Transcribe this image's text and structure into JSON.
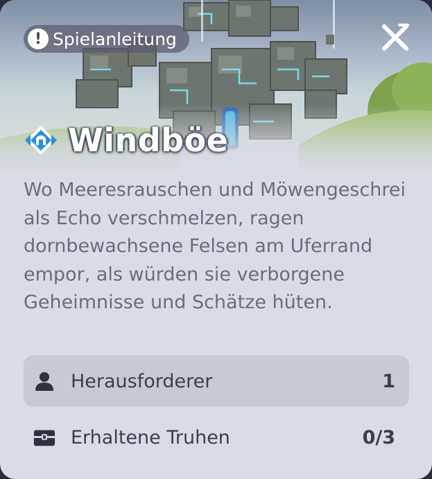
{
  "guide": {
    "label": "Spielanleitung",
    "icon": "exclamation-icon"
  },
  "close": {
    "icon": "close-icon"
  },
  "title": {
    "text": "Windböe",
    "icon": "domain-gate-icon"
  },
  "description": "Wo Meeresrauschen und Möwengeschrei als Echo verschmelzen, ragen dornbewachsene Felsen am Uferrand empor, als würden sie verborgene Geheimnisse und Schätze hüten.",
  "stats": [
    {
      "label": "Herausforderer",
      "value": "1",
      "icon": "person-icon"
    },
    {
      "label": "Erhaltene Truhen",
      "value": "0/3",
      "icon": "chest-icon"
    }
  ],
  "colors": {
    "panel": "#d9dbe6",
    "highlight_row": "#c8c9d5",
    "text": "#3c3e4e",
    "description": "#6b6d7d",
    "rune_glow": "#7fe3f0"
  }
}
